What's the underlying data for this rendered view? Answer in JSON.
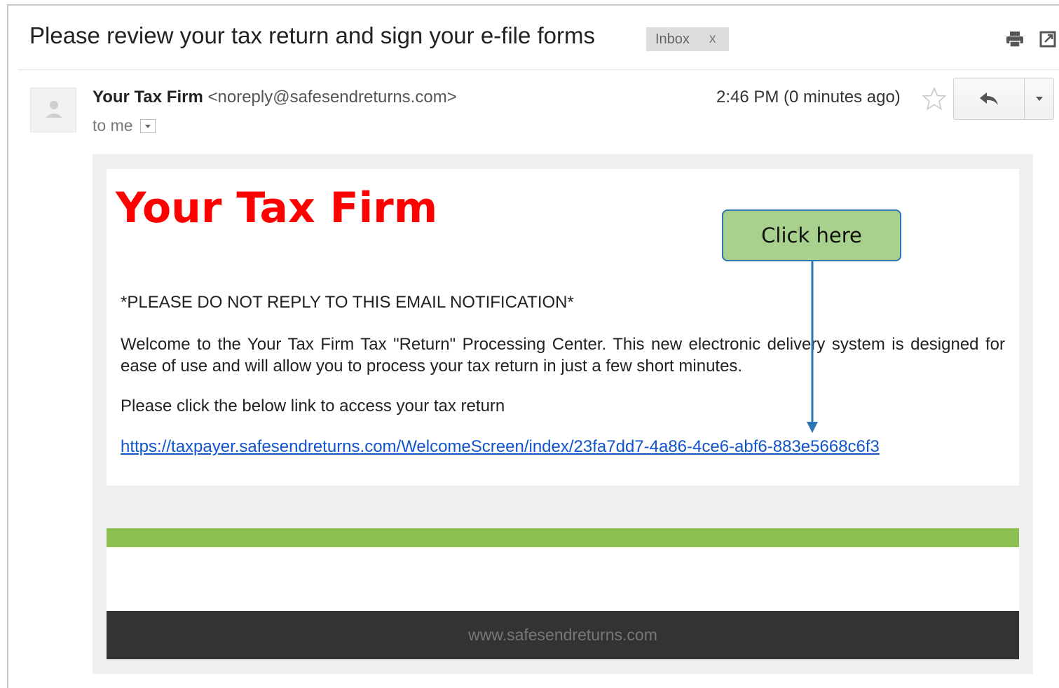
{
  "email": {
    "subject": "Please review your tax return and sign your e-file forms",
    "label": "Inbox",
    "label_close": "x",
    "sender_name": "Your Tax Firm",
    "sender_email": "<noreply@safesendreturns.com>",
    "recipient": "to me",
    "timestamp": "2:46 PM (0 minutes ago)"
  },
  "body": {
    "brand": "Your Tax Firm",
    "notice": "*PLEASE DO NOT REPLY TO THIS EMAIL NOTIFICATION*",
    "welcome": "Welcome to the Your Tax Firm Tax \"Return\" Processing Center. This new electronic delivery system is designed for ease of use and will allow you to process your tax return in just a few short minutes.",
    "instruction": "Please click the below link to access your tax return",
    "link": "https://taxpayer.safesendreturns.com/WelcomeScreen/index/23fa7dd7-4a86-4ce6-abf6-883e5668c6f3",
    "footer": "www.safesendreturns.com"
  },
  "callout": {
    "text": "Click here"
  },
  "icons": {
    "print": "print-icon",
    "new_window": "new-window-icon",
    "star": "star-icon",
    "reply": "reply-icon",
    "avatar": "person-icon"
  },
  "colors": {
    "brand_red": "#ff0000",
    "link_blue": "#1155cc",
    "green_bar": "#8cc152",
    "footer_dark": "#333333",
    "callout_fill": "#a9d18e",
    "callout_border": "#2e75b6"
  }
}
